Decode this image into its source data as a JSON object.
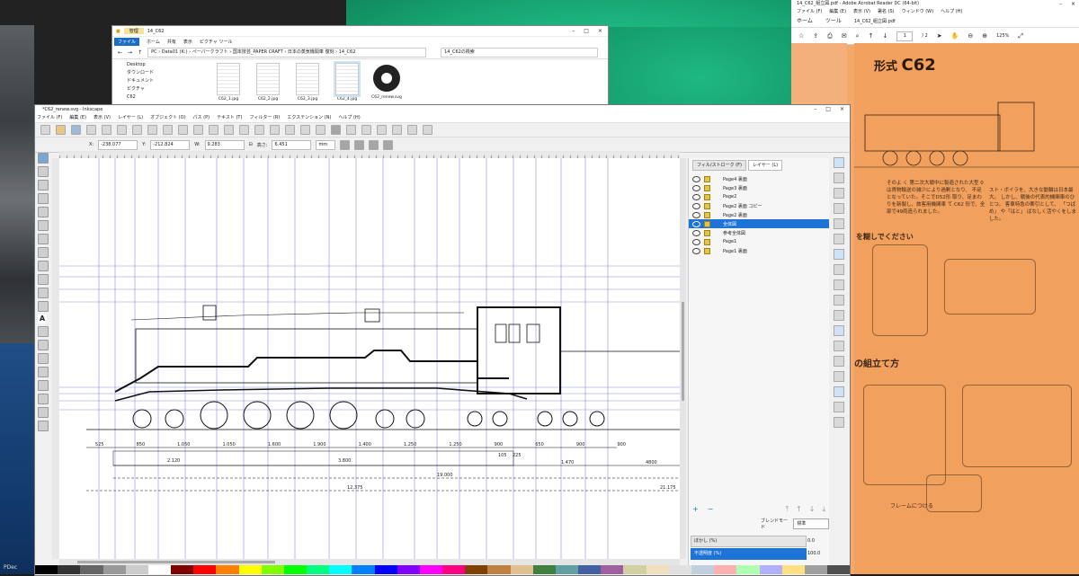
{
  "desktop": {
    "taskbar_label": "PDec"
  },
  "explorer": {
    "title": "14_C62",
    "manage_tab": "管理",
    "tools_tab": "ピクチャ ツール",
    "ribbon": [
      "ファイル",
      "ホーム",
      "共有",
      "表示"
    ],
    "address": "PC › Data01 (K:) › ペーパークラフト › 国本技芸_PAPER CRAFT › 日本の蒸気機関車 復刻 › 14_C62",
    "search_placeholder": "14_C62の検索",
    "nav": [
      "Desktop",
      "ダウンロード",
      "ドキュメント",
      "ピクチャ",
      "C62"
    ],
    "files": [
      {
        "name": "C62_1.jpg"
      },
      {
        "name": "C62_2.jpg"
      },
      {
        "name": "C62_3.jpg"
      },
      {
        "name": "C62_4.jpg"
      },
      {
        "name": "C62_renew.svg"
      }
    ]
  },
  "acrobat": {
    "title": "14_C62_組立図.pdf - Adobe Acrobat Reader DC (64-bit)",
    "menu": [
      "ファイル (F)",
      "編集 (E)",
      "表示 (V)",
      "署名 (S)",
      "ウィンドウ (W)",
      "ヘルプ (H)"
    ],
    "tabs": [
      "ホーム",
      "ツール",
      "14_C62_組立図.pdf"
    ],
    "page_current": "1",
    "page_total": "/ 2",
    "zoom": "125%",
    "heading_prefix": "形式",
    "heading_model": "C62",
    "body_text": "そのよ く 第二次大戦中に製造された大型 0は貨物輸送の減少により過剰となり、 不足となっていた。そこでD52形 取り、足まわりを新製し、旅客用機関車 て C62 形で、全部で49両造られました。",
    "right_text": "スト・ボイラを、大きな動輪は日本最大。 しかし、戦後の代表的機関車のひとつ。 客車特急の牽引として、 「つばめ」 や「はと」 ばなしく活やくをしました。",
    "caption1": "の組立て方",
    "caption2": "フレームにつける",
    "caption3": "を糊しでください"
  },
  "inkscape": {
    "title": "*C62_renew.svg - Inkscape",
    "menu": [
      "ファイル (F)",
      "編集 (E)",
      "表示 (V)",
      "レイヤー (L)",
      "オブジェクト (O)",
      "パス (P)",
      "テキスト (T)",
      "フィルター (R)",
      "エクステンション (N)",
      "ヘルプ (H)"
    ],
    "controls": {
      "x_label": "X:",
      "x": "-238.077",
      "y_label": "Y:",
      "y": "-212.824",
      "w_label": "W:",
      "w": "9.283",
      "h_label": "高さ:",
      "h": "6.451",
      "unit": "mm"
    },
    "panel_tabs": [
      "フィル/ストローク (F)",
      "レイヤー (L)"
    ],
    "layers": [
      {
        "name": "Page4 裏面",
        "selected": false
      },
      {
        "name": "Page3 裏面",
        "selected": false
      },
      {
        "name": "Page2",
        "selected": false
      },
      {
        "name": "Page2 裏面 コピー",
        "selected": false
      },
      {
        "name": "Page2 裏面",
        "selected": false
      },
      {
        "name": "全体図",
        "selected": true
      },
      {
        "name": "参考全体図",
        "selected": false
      },
      {
        "name": "Page1",
        "selected": false
      },
      {
        "name": "Page1 裏面",
        "selected": false
      }
    ],
    "blend_label": "ブレンドモード",
    "blend_value": "標準",
    "blur_label": "ぼかし (%)",
    "blur_value": "0.0",
    "opacity_label": "不透明度 (%)",
    "opacity_value": "100.0",
    "dims_top": [
      "525",
      "850",
      "1.050",
      "1.050",
      "1.600",
      "1.900",
      "1.400",
      "1.250",
      "1.250",
      "900",
      "650",
      "900",
      "900"
    ],
    "dims_mid": [
      "2.120",
      "3.800",
      "105",
      "225",
      "1.470",
      "4800"
    ],
    "dims_low": [
      "19.000",
      "12.375",
      "21.175"
    ]
  },
  "colors": {
    "accent": "#1e73d6",
    "acrobat_page": "#f2a05d",
    "drawing": "#111111",
    "guide": "#5b5bd6"
  }
}
